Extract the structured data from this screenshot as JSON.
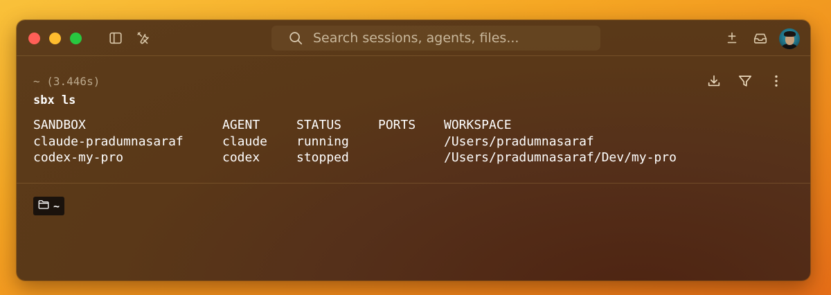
{
  "titlebar": {
    "search_placeholder": "Search sessions, agents, files...",
    "icons": [
      "sidebar-toggle-icon",
      "tools-icon",
      "search-icon",
      "plus-minus-icon",
      "inbox-icon"
    ]
  },
  "block": {
    "timing": "~ (3.446s)",
    "command": "sbx ls",
    "actions": [
      "download-icon",
      "filter-icon",
      "more-vertical-icon"
    ],
    "table": {
      "headers": [
        "SANDBOX",
        "AGENT",
        "STATUS",
        "PORTS",
        "WORKSPACE"
      ],
      "rows": [
        [
          "claude-pradumnasaraf",
          "claude",
          "running",
          "",
          "/Users/pradumnasaraf"
        ],
        [
          "codex-my-pro",
          "codex",
          "stopped",
          "",
          "/Users/pradumnasaraf/Dev/my-pro"
        ]
      ]
    }
  },
  "prompt": {
    "directory": "~",
    "icon": "folder-icon"
  },
  "colors": {
    "close": "#ff5f57",
    "minimize": "#febc2e",
    "maximize": "#28c840",
    "window_bg": "#5a3818",
    "desktop_bg": "#f5a623"
  }
}
